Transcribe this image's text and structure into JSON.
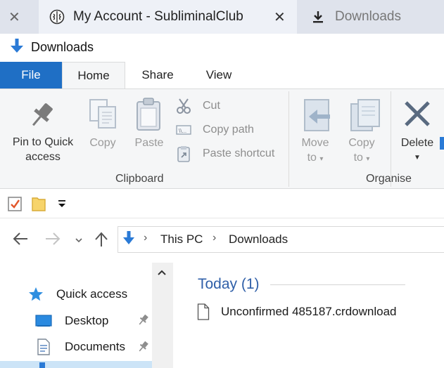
{
  "tabs": [
    {
      "label": "My Account - SubliminalClub",
      "icon": "brain-icon",
      "active": true
    },
    {
      "label": "Downloads",
      "icon": "download-icon",
      "active": false
    }
  ],
  "window": {
    "title": "Downloads",
    "icon": "down-arrow-icon"
  },
  "ribbon_tabs": [
    {
      "label": "File"
    },
    {
      "label": "Home"
    },
    {
      "label": "Share"
    },
    {
      "label": "View"
    }
  ],
  "ribbon": {
    "clipboard": {
      "group_label": "Clipboard",
      "pin_line1": "Pin to Quick",
      "pin_line2": "access",
      "copy": "Copy",
      "paste": "Paste",
      "cut": "Cut",
      "copy_path": "Copy path",
      "paste_shortcut": "Paste shortcut"
    },
    "organise": {
      "group_label": "Organise",
      "move_to_line1": "Move",
      "move_to_line2": "to",
      "copy_to_line1": "Copy",
      "copy_to_line2": "to",
      "delete": "Delete"
    }
  },
  "address": {
    "crumbs": [
      "This PC",
      "Downloads"
    ]
  },
  "nav": {
    "items": [
      {
        "label": "Quick access",
        "icon": "star-icon"
      },
      {
        "label": "Desktop",
        "icon": "desktop-icon",
        "pinned": true
      },
      {
        "label": "Documents",
        "icon": "documents-icon",
        "pinned": true
      }
    ]
  },
  "content": {
    "group_header": "Today (1)",
    "files": [
      {
        "name": "Unconfirmed 485187.crdownload",
        "icon": "file-icon"
      }
    ]
  },
  "colors": {
    "accent": "#1f6fc5",
    "group_header": "#2f5fa8",
    "tab_strip": "#dfe3ec"
  }
}
